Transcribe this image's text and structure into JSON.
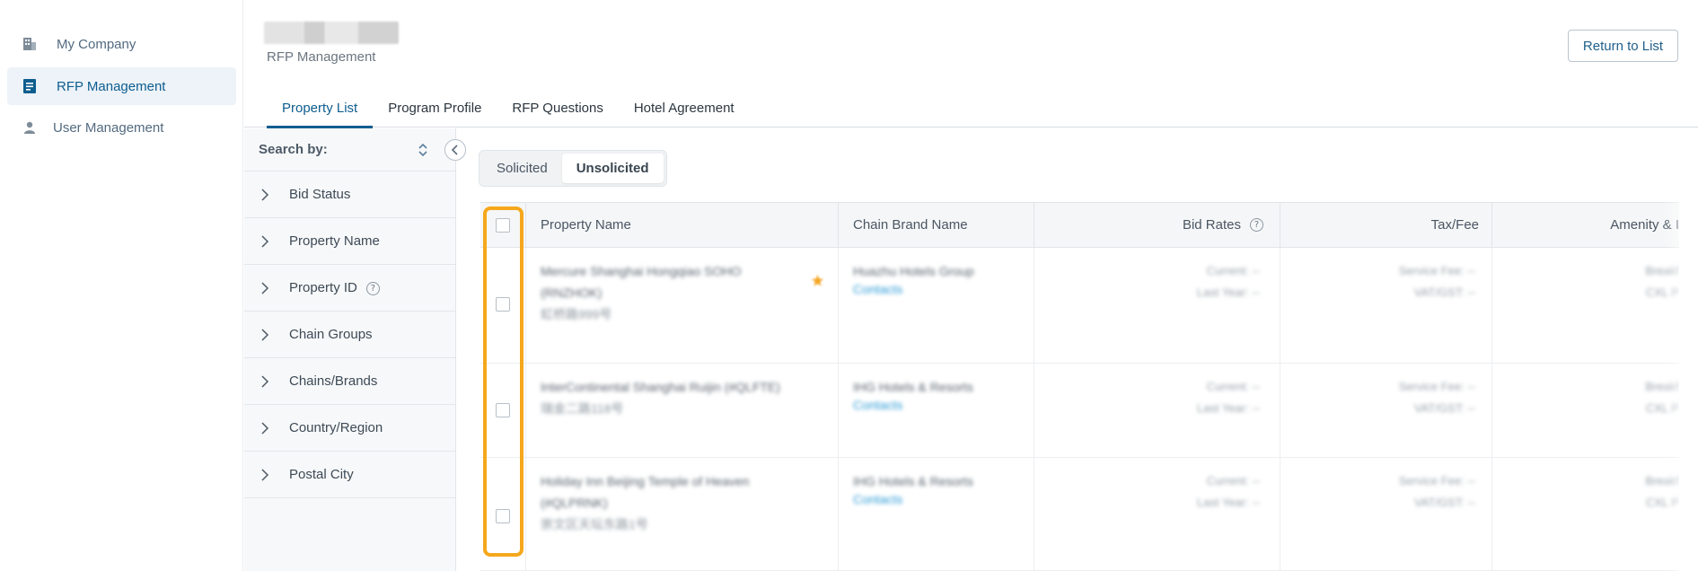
{
  "sidebar": {
    "items": [
      {
        "label": "My Company",
        "icon": "building-icon"
      },
      {
        "label": "RFP Management",
        "icon": "document-icon"
      },
      {
        "label": "User Management",
        "icon": "user-icon"
      }
    ]
  },
  "header": {
    "breadcrumb": "RFP Management",
    "return_label": "Return to List",
    "tabs": [
      "Property List",
      "Program Profile",
      "RFP Questions",
      "Hotel Agreement"
    ]
  },
  "filter": {
    "title": "Search by:",
    "items": [
      "Bid Status",
      "Property Name",
      "Property ID",
      "Chain Groups",
      "Chains/Brands",
      "Country/Region",
      "Postal City"
    ],
    "help_mark": "?"
  },
  "toggle": {
    "options": [
      "Solicited",
      "Unsolicited"
    ],
    "selected": "Unsolicited"
  },
  "table": {
    "headers": {
      "property": "Property Name",
      "chain": "Chain Brand Name",
      "bid": "Bid Rates",
      "tax": "Tax/Fee",
      "amenity": "Amenity & I"
    },
    "help_mark": "?",
    "rows": [
      {
        "name_line1": "Mercure Shanghai Hongqiao SOHO",
        "name_line2": "(RNZHOK)",
        "address": "虹桥路999号",
        "chain": "Huazhu Hotels Group",
        "contacts": "Contacts",
        "bid_current": "Current: --",
        "bid_last": "Last Year: --",
        "tax1": "Service Fee: --",
        "tax2": "VAT/GST: --",
        "amen1": "Breakf",
        "amen2": "CXL P"
      },
      {
        "name_line1": "InterContinental Shanghai Ruijin (#QLFTE)",
        "name_line2": "",
        "address": "瑞金二路118号",
        "chain": "IHG Hotels & Resorts",
        "contacts": "Contacts",
        "bid_current": "Current: --",
        "bid_last": "Last Year: --",
        "tax1": "Service Fee: --",
        "tax2": "VAT/GST: --",
        "amen1": "Breakf",
        "amen2": "CXL P"
      },
      {
        "name_line1": "Holiday Inn Beijing Temple of Heaven",
        "name_line2": "(#QLPRNK)",
        "address": "崇文区天坛东路1号",
        "chain": "IHG Hotels & Resorts",
        "contacts": "Contacts",
        "bid_current": "Current: --",
        "bid_last": "Last Year: --",
        "tax1": "Service Fee: --",
        "tax2": "VAT/GST: --",
        "amen1": "Breakf",
        "amen2": "CXL P"
      }
    ]
  },
  "colors": {
    "accent": "#0d5d8f",
    "highlight": "#f5a81c",
    "link": "#2b9ad6",
    "star": "#f5a623"
  }
}
